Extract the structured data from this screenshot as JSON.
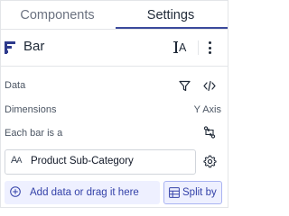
{
  "tabs": [
    {
      "label": "Components",
      "active": false
    },
    {
      "label": "Settings",
      "active": true
    }
  ],
  "chart": {
    "name": "Bar",
    "icon": "bar-chart-icon"
  },
  "sections": {
    "data_label": "Data",
    "dimensions_label": "Dimensions",
    "dimensions_axis": "Y Axis",
    "each_bar_label": "Each bar is a"
  },
  "dimension_field": {
    "type_icon": "text-type-icon",
    "value": "Product Sub-Category"
  },
  "add_data": {
    "label": "Add data or drag it here"
  },
  "split_by": {
    "label": "Split by"
  },
  "colors": {
    "accent": "#3b4a9c",
    "accent_light": "#eef0ff",
    "border": "#e3e5e8",
    "text_link": "#3341a8"
  }
}
